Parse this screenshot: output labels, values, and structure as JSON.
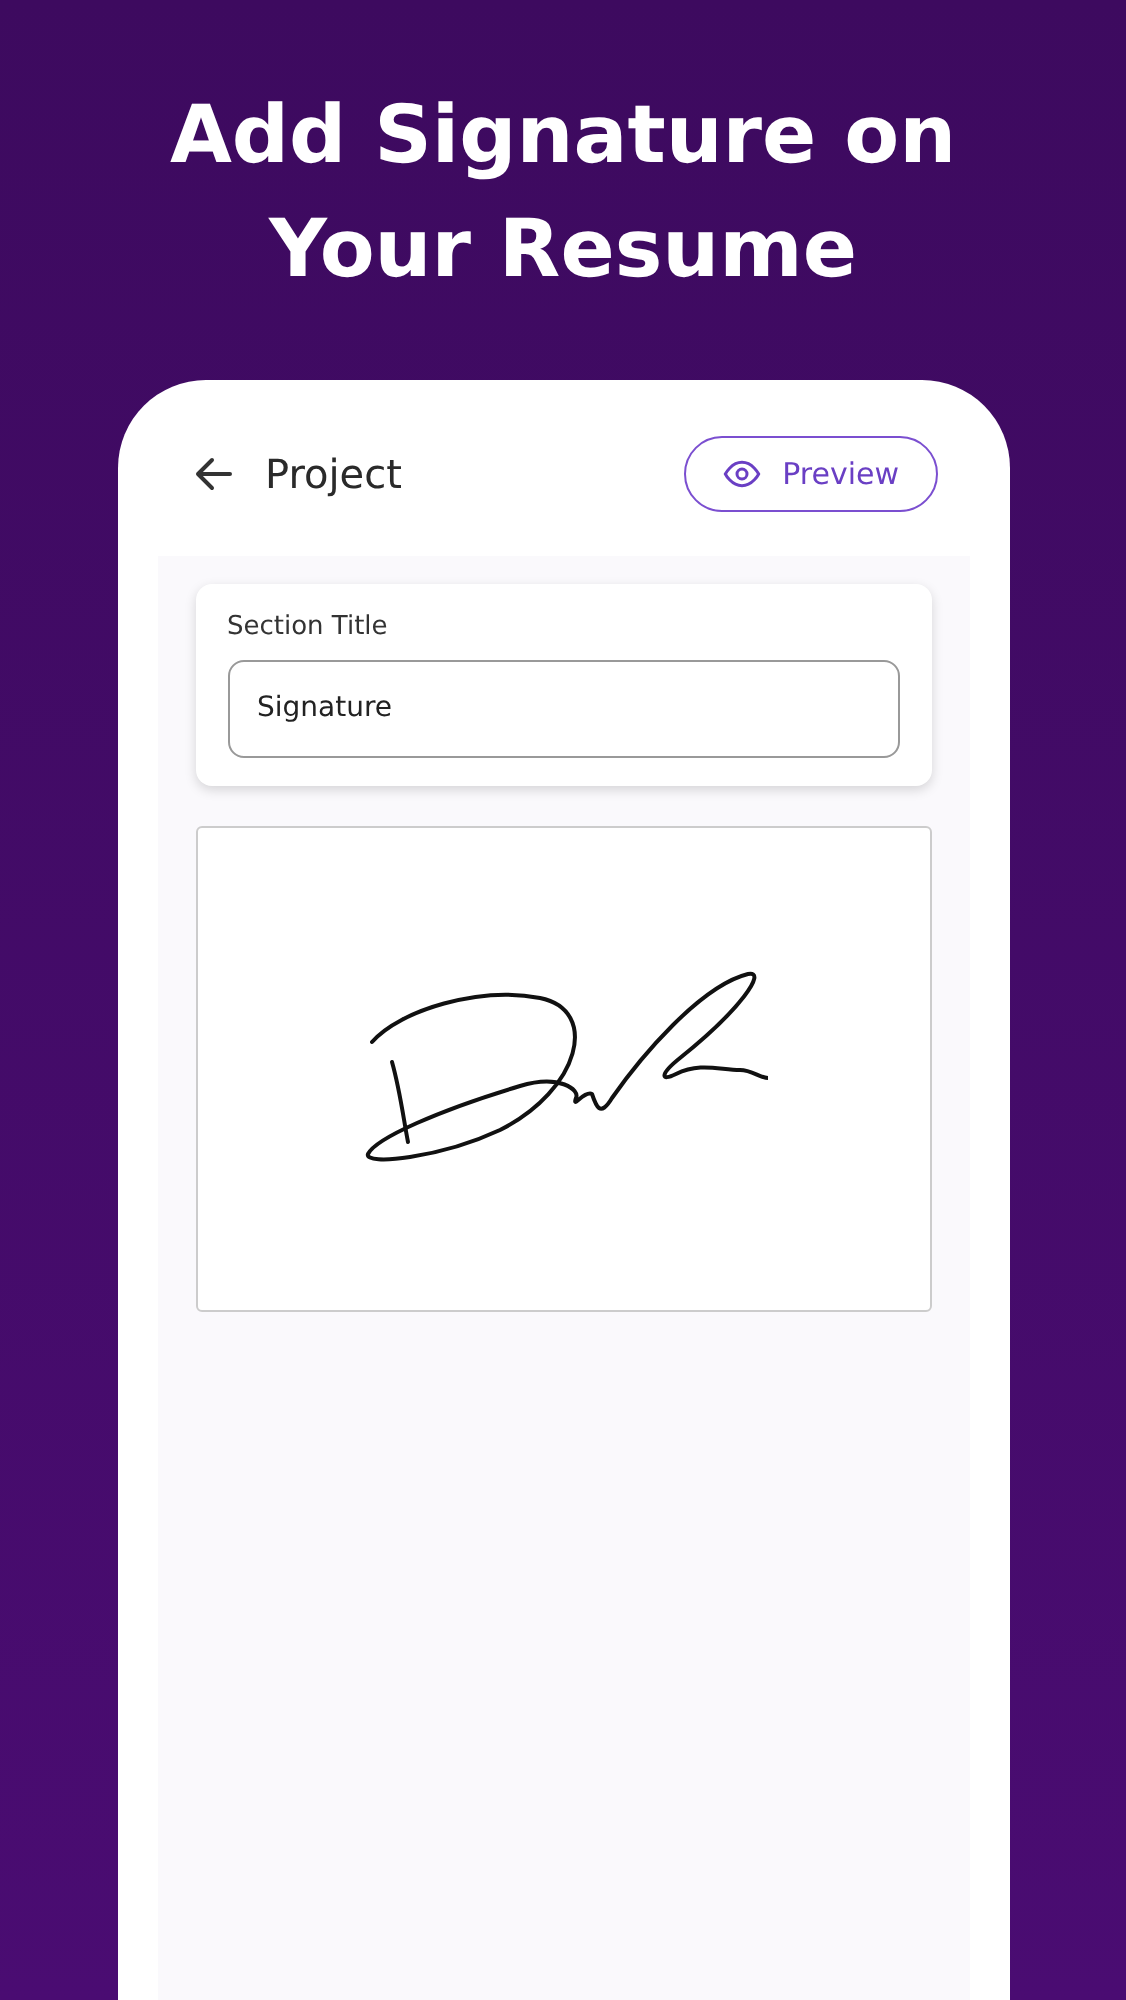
{
  "headline": "Add Signature on Your Resume",
  "header": {
    "title": "Project",
    "preview_button": "Preview"
  },
  "section": {
    "label": "Section Title",
    "value": "Signature"
  }
}
